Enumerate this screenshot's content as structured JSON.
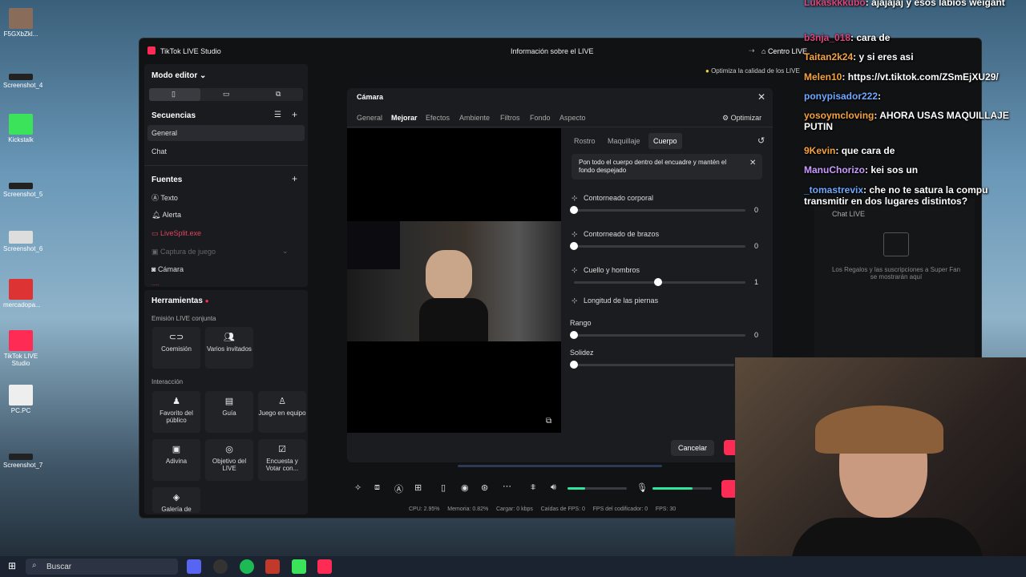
{
  "desktop_icons": [
    {
      "label": "F5GXbZkl..."
    },
    {
      "label": "Screenshot_4"
    },
    {
      "label": "Kickstalk"
    },
    {
      "label": "Screenshot_5"
    },
    {
      "label": "Screenshot_6"
    },
    {
      "label": "mercadopa..."
    },
    {
      "label": "TikTok LIVE Studio"
    },
    {
      "label": "PC.PC"
    },
    {
      "label": "Screenshot_7"
    }
  ],
  "window": {
    "app_title": "TikTok LIVE Studio",
    "center_title": "Información sobre el LIVE",
    "centro_live": "Centro LIVE",
    "optimize_hint": "Optimiza la calidad de los LIVE"
  },
  "left": {
    "mode_editor": "Modo editor",
    "sequences_title": "Secuencias",
    "sequences": [
      "General",
      "Chat"
    ],
    "sources_title": "Fuentes",
    "sources": [
      "Texto",
      "Alerta",
      "LiveSplit.exe",
      "Captura de juego",
      "Cámara",
      "....."
    ],
    "tools_title": "Herramientas",
    "joint_title": "Emisión LIVE conjunta",
    "joint": [
      "Coemisión",
      "Varios invitados"
    ],
    "interaction_title": "Interacción",
    "interaction": [
      "Favorito del público",
      "Guía",
      "Juego en equipo",
      "Adivina",
      "Objetivo del LIVE",
      "Encuesta y Votar con...",
      "Galería de"
    ]
  },
  "camera": {
    "title": "Cámara",
    "tabs": [
      "General",
      "Mejorar",
      "Efectos",
      "Ambiente",
      "Filtros",
      "Fondo",
      "Aspecto"
    ],
    "optimize": "Optimizar",
    "subtabs": [
      "Rostro",
      "Maquillaje",
      "Cuerpo"
    ],
    "notice": "Pon todo el cuerpo dentro del encuadre y mantén el fondo despejado",
    "sliders": [
      {
        "label": "Contorneado corporal",
        "value": "0",
        "level": 0
      },
      {
        "label": "Contorneado de brazos",
        "value": "0",
        "level": 0
      },
      {
        "label": "Cuello y hombros",
        "value": "1",
        "level": 0.49
      },
      {
        "label": "Longitud de las piernas",
        "value": "",
        "level": null
      },
      {
        "label": "Rango",
        "value": "0",
        "level": 0
      },
      {
        "label": "Solidez",
        "value": "",
        "level": 0
      }
    ],
    "cancel": "Cancelar"
  },
  "statusbar": {
    "cpu": "CPU: 2.95%",
    "mem": "Memoria: 0.82%",
    "load": "Cargar: 0 kbps",
    "fps_drop": "Caídas de FPS: 0",
    "enc": "FPS del codificador: 0",
    "fps": "FPS: 30"
  },
  "gifts": {
    "text": "Los Regalos y las suscripciones a Super Fan se mostrarán aquí",
    "chat_live": "Chat LIVE"
  },
  "chat": [
    {
      "user": "Lukaskkkubo",
      "msg": ": ajajajaj y esos labios weigant",
      "color": "#e0457b"
    },
    {
      "user": "b3nja_018",
      "msg": ": cara de",
      "color": "#e0457b"
    },
    {
      "user": "Taitan2k24",
      "msg": ": y si eres asi",
      "color": "#f4a340"
    },
    {
      "user": "Melen10",
      "msg": ": https://vt.tiktok.com/ZSmEjXU29/",
      "color": "#f4a340"
    },
    {
      "user": "ponypisador222",
      "msg": ":",
      "color": "#6fa8ff"
    },
    {
      "user": "yosoymcloving",
      "msg": ": AHORA USAS MAQUILLAJE PUTIN",
      "color": "#f4a340"
    },
    {
      "user": "9Kevin",
      "msg": ": que cara de",
      "color": "#f4a340"
    },
    {
      "user": "ManuChorizo",
      "msg": ": kei sos un",
      "color": "#c99cff"
    },
    {
      "user": "_tomastrevix",
      "msg": ": che no te satura la compu transmitir en dos lugares distintos?",
      "color": "#6fa8ff"
    }
  ],
  "taskbar": {
    "search": "Buscar"
  },
  "colors": {
    "accent": "#fe2c55",
    "green": "#2ee6a0"
  }
}
